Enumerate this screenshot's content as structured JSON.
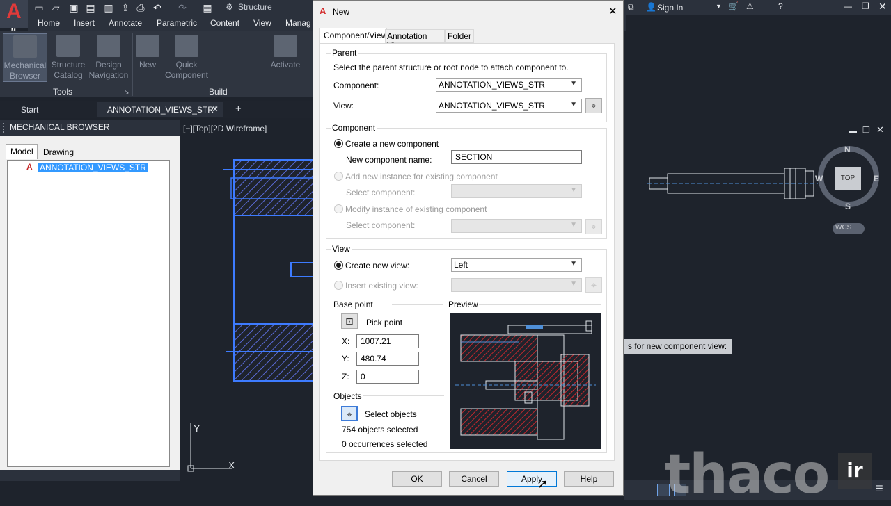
{
  "app": {
    "logo_letter": "A",
    "logo_sub": "M",
    "workspace": "Structure",
    "sign_in": "Sign In"
  },
  "ribbon": {
    "tabs": [
      "Home",
      "Insert",
      "Annotate",
      "Parametric",
      "Content",
      "View",
      "Manag"
    ],
    "tools": [
      "Mechanical Browser",
      "Structure Catalog",
      "Design Navigation"
    ],
    "build": [
      "New",
      "Quick Component",
      "Activate"
    ],
    "panel_tools": "Tools",
    "panel_build": "Build"
  },
  "doc_tabs": {
    "start": "Start",
    "current": "ANNOTATION_VIEWS_STR*"
  },
  "browser": {
    "title": "MECHANICAL BROWSER",
    "tab_model": "Model",
    "tab_drawing": "Drawing",
    "node": "ANNOTATION_VIEWS_STR"
  },
  "viewport": {
    "label": "[−][Top][2D Wireframe]",
    "compass": {
      "n": "N",
      "s": "S",
      "e": "E",
      "w": "W",
      "top": "TOP",
      "wcs": "WCS"
    },
    "tooltip": "s for new component view:"
  },
  "dialog": {
    "title": "New",
    "tabs": [
      "Component/View",
      "Annotation View",
      "Folder"
    ],
    "parent": {
      "legend": "Parent",
      "instruction": "Select the parent structure or root node to attach component to.",
      "component_label": "Component:",
      "component_value": "ANNOTATION_VIEWS_STR",
      "view_label": "View:",
      "view_value": "ANNOTATION_VIEWS_STR"
    },
    "component": {
      "legend": "Component",
      "create_new": "Create a new component",
      "name_label": "New component name:",
      "name_value": "SECTION",
      "add_instance": "Add new instance for existing component",
      "select_component_1": "Select component:",
      "modify_instance": "Modify instance of existing component",
      "select_component_2": "Select component:"
    },
    "view": {
      "legend": "View",
      "create_new_view": "Create new view:",
      "create_new_view_value": "Left",
      "insert_existing": "Insert existing view:"
    },
    "base_point": {
      "legend": "Base point",
      "pick_point": "Pick point",
      "x_label": "X:",
      "x_value": "1007.21",
      "y_label": "Y:",
      "y_value": "480.74",
      "z_label": "Z:",
      "z_value": "0"
    },
    "objects": {
      "legend": "Objects",
      "select_objects": "Select objects",
      "objects_selected": "754 objects selected",
      "occurrences_selected": "0 occurrences selected"
    },
    "preview_legend": "Preview",
    "buttons": {
      "ok": "OK",
      "cancel": "Cancel",
      "apply": "Apply",
      "help": "Help"
    }
  },
  "watermark": {
    "text": "thaco",
    "box": "ir"
  },
  "colors": {
    "accent": "#0078d7",
    "canvas": "#1e232c",
    "cad_blue": "#4a7cff",
    "cad_red": "#c0272d"
  }
}
